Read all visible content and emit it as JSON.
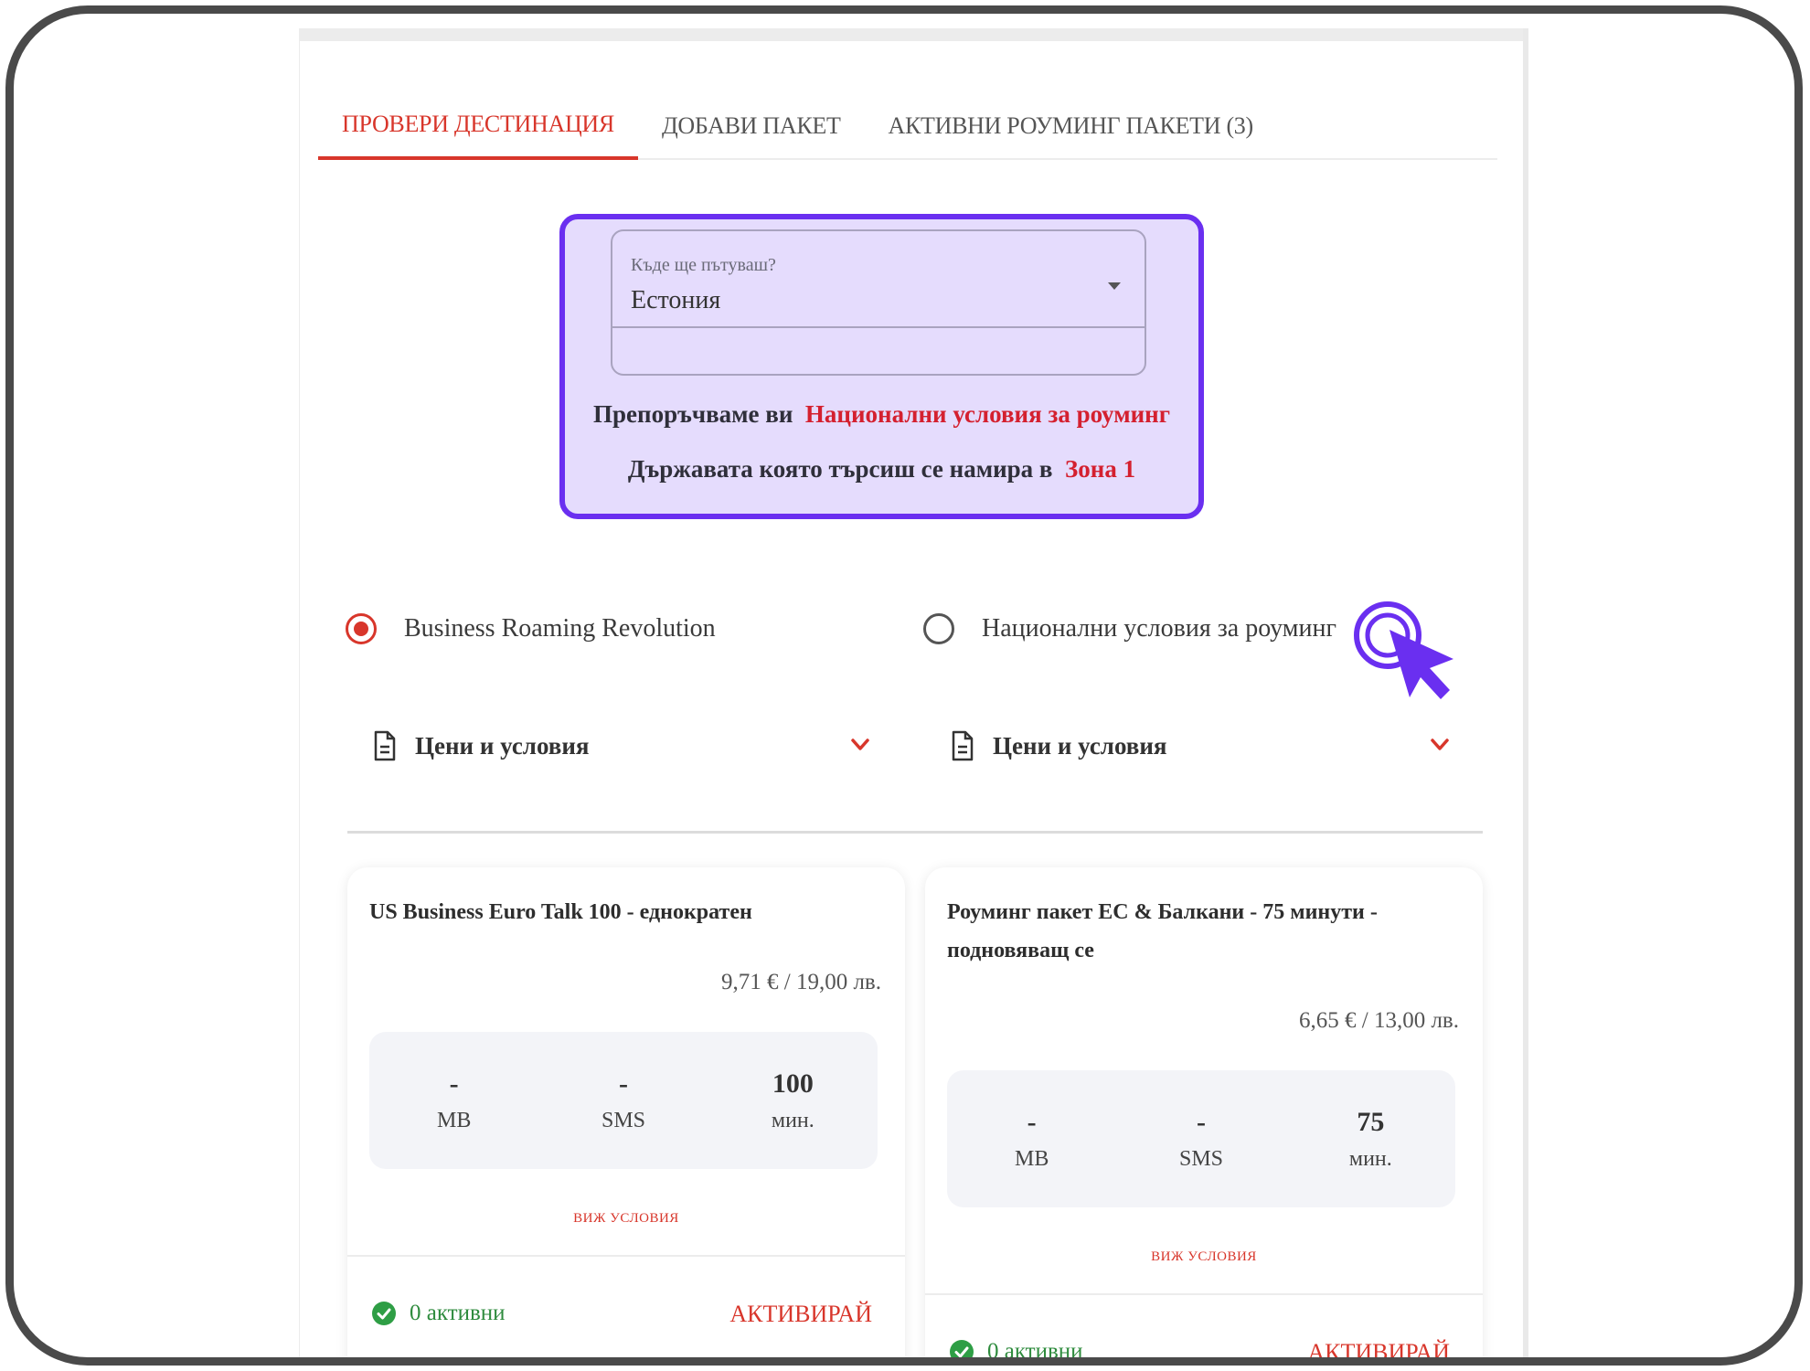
{
  "tabs": [
    {
      "label": "ПРОВЕРИ ДЕСТИНАЦИЯ",
      "active": true
    },
    {
      "label": "ДОБАВИ ПАКЕТ",
      "active": false
    },
    {
      "label": "АКТИВНИ РОУМИНГ ПАКЕТИ (3)",
      "active": false
    }
  ],
  "destination": {
    "label": "Къде ще пътуваш?",
    "value": "Естония",
    "recommend_prefix": "Препоръчваме ви",
    "recommend_value": "Национални условия за роуминг",
    "zone_prefix": "Държавата която търсиш се намира в",
    "zone_value": "Зона 1"
  },
  "options": [
    {
      "label": "Business Roaming Revolution",
      "selected": true,
      "conditions_label": "Цени и условия"
    },
    {
      "label": "Национални условия за роуминг",
      "selected": false,
      "conditions_label": "Цени и условия"
    }
  ],
  "packages": [
    {
      "title": "US Business Euro Talk 100 - еднократен",
      "price": "9,71 € / 19,00 лв.",
      "mb": "-",
      "mb_unit": "MB",
      "sms": "-",
      "sms_unit": "SMS",
      "min": "100",
      "min_unit": "мин.",
      "terms": "ВИЖ УСЛОВИЯ",
      "active_count": "0 активни",
      "activate": "АКТИВИРАЙ"
    },
    {
      "title": "Роуминг пакет ЕС & Балкани - 75 минути - подновяващ се",
      "price": "6,65 € / 13,00 лв.",
      "mb": "-",
      "mb_unit": "MB",
      "sms": "-",
      "sms_unit": "SMS",
      "min": "75",
      "min_unit": "мин.",
      "terms": "ВИЖ УСЛОВИЯ",
      "active_count": "0 активни",
      "activate": "АКТИВИРАЙ"
    }
  ],
  "colors": {
    "accent": "#d8362b",
    "highlight_border": "#6a2ff0",
    "highlight_fill": "#e5dcfd",
    "success": "#2e8b3d"
  },
  "icons": [
    "document-icon",
    "chevron-down-icon",
    "check-circle-icon",
    "pointer-cursor-icon"
  ]
}
